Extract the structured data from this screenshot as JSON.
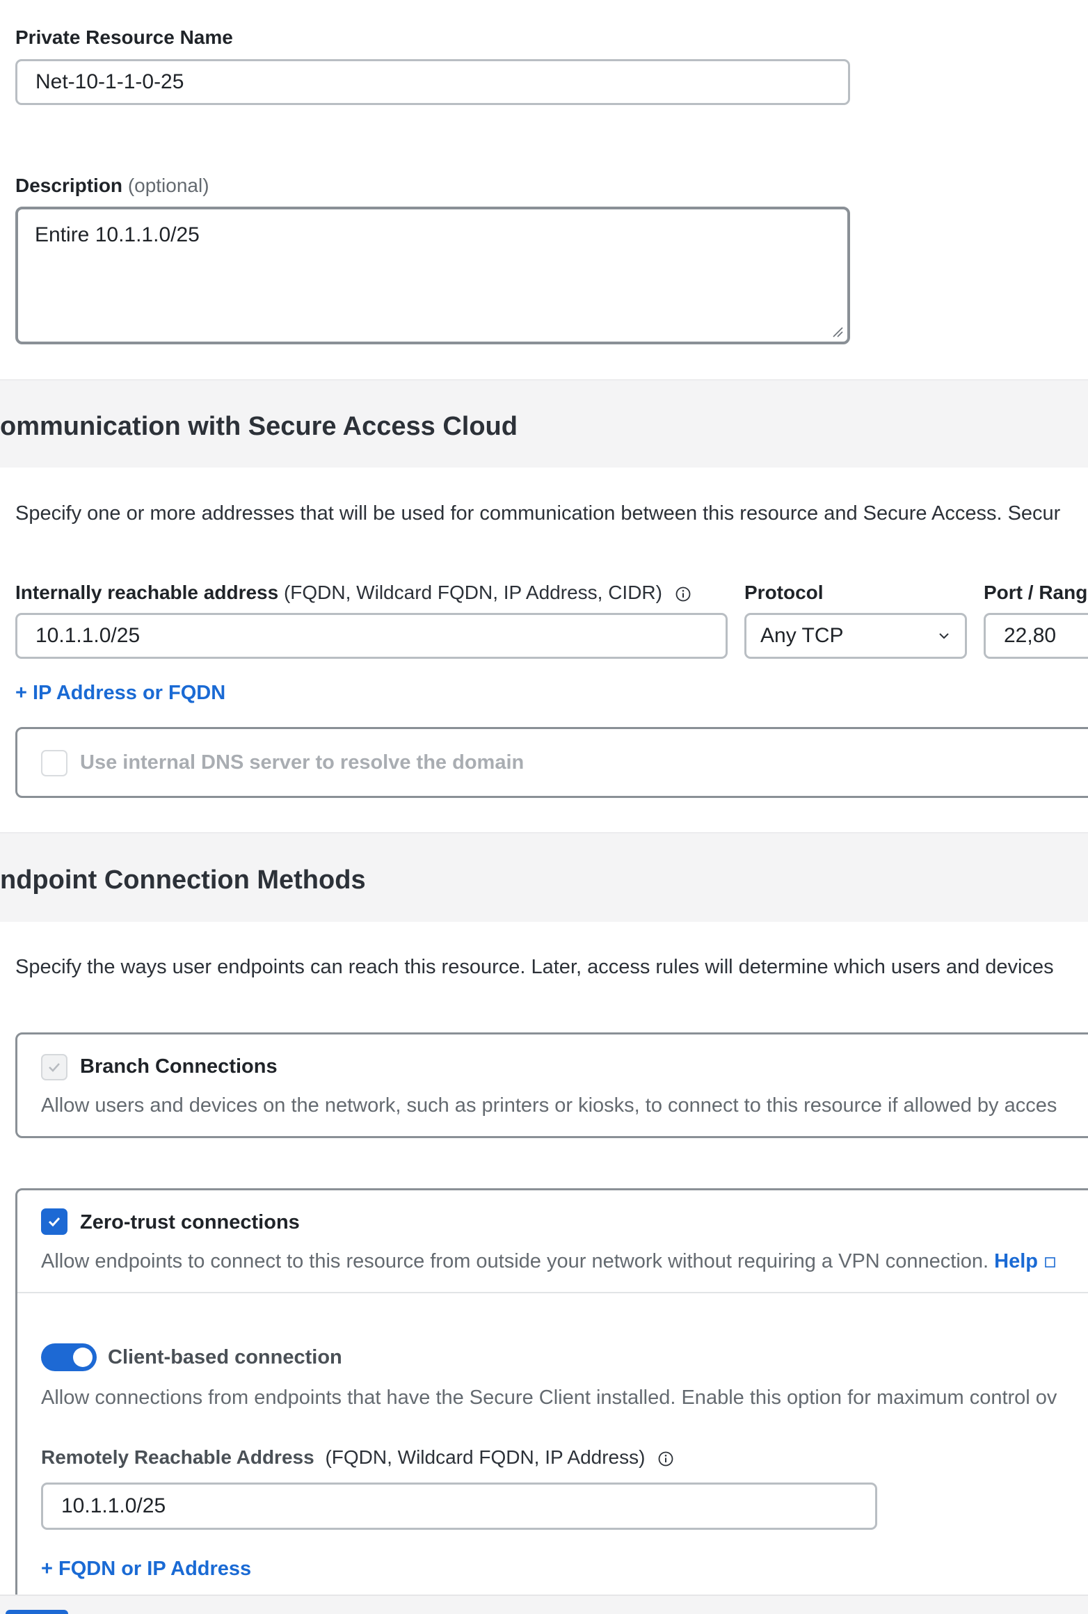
{
  "resource": {
    "name_label": "Private Resource Name",
    "name_value": "Net-10-1-1-0-25",
    "description_label": "Description",
    "description_hint": "(optional)",
    "description_value": "Entire 10.1.1.0/25"
  },
  "communication": {
    "title": "ommunication with Secure Access Cloud",
    "description": "Specify one or more addresses that will be used for communication between this resource and Secure Access. Secur",
    "address_label": "Internally reachable address",
    "address_hint": "(FQDN, Wildcard FQDN, IP Address, CIDR)",
    "address_value": "10.1.1.0/25",
    "protocol_label": "Protocol",
    "protocol_value": "Any TCP",
    "port_label": "Port / Rang",
    "port_value": "22,80",
    "add_address_link": "+ IP Address or FQDN",
    "dns_checkbox_label": "Use internal DNS server to resolve the domain"
  },
  "endpoint": {
    "title": "ndpoint Connection Methods",
    "description": "Specify the ways user endpoints can reach this resource. Later, access rules will determine which users and devices",
    "branch": {
      "label": "Branch Connections",
      "desc": "Allow users and devices on the network, such as printers or kiosks, to connect to this resource if allowed by acces"
    },
    "zero_trust": {
      "label": "Zero-trust connections",
      "desc": "Allow endpoints to connect to this resource from outside your network without requiring a VPN connection.",
      "help_link": "Help"
    },
    "client": {
      "label": "Client-based connection",
      "desc": "Allow connections from endpoints that have the Secure Client installed. Enable this option for maximum control ov",
      "remote_label": "Remotely Reachable Address",
      "remote_hint": "(FQDN, Wildcard FQDN, IP Address)",
      "remote_value": "10.1.1.0/25",
      "add_link": "+ FQDN or IP Address"
    }
  },
  "colors": {
    "accent": "#1d69d4",
    "link": "#1a6ad4",
    "section_band": "#f4f4f5"
  }
}
